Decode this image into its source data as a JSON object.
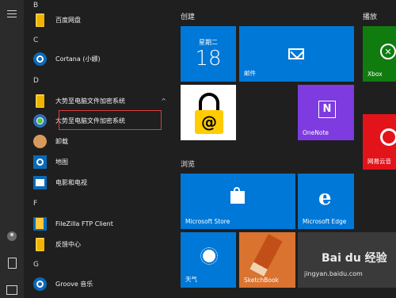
{
  "start_menu": {
    "rail": {
      "menu_icon": "hamburger-icon",
      "user_icon": "user-icon",
      "documents_icon": "document-icon",
      "pictures_icon": "pictures-icon"
    },
    "app_list": {
      "letters": {
        "b": "B",
        "c": "C",
        "d": "D",
        "f": "F",
        "g": "G"
      },
      "items": [
        {
          "label": "百度网盘",
          "icon": "folder-icon"
        },
        {
          "label": "Cortana (小娜)",
          "icon": "cortana-icon"
        },
        {
          "label": "大势至电脑文件加密系统",
          "icon": "folder-icon",
          "chevron": "^"
        },
        {
          "label": "大势至电脑文件加密系统",
          "icon": "app-icon"
        },
        {
          "label": "卸载",
          "icon": "uninstall-icon"
        },
        {
          "label": "地图",
          "icon": "maps-icon"
        },
        {
          "label": "电影和电视",
          "icon": "movies-icon"
        },
        {
          "label": "FileZilla FTP Client",
          "icon": "filezilla-icon"
        },
        {
          "label": "反馈中心",
          "icon": "feedback-icon"
        },
        {
          "label": "Groove 音乐",
          "icon": "groove-icon"
        }
      ]
    },
    "tiles": {
      "groups": {
        "create": "创建",
        "browse": "浏览",
        "play": "播放"
      },
      "calendar": {
        "day": "星期二",
        "date": "18"
      },
      "mail": {
        "label": "邮件"
      },
      "onenote": {
        "label": "OneNote",
        "glyph": "N"
      },
      "xbox": {
        "label": "Xbox",
        "glyph": "✕"
      },
      "netease": {
        "label": "网易云音"
      },
      "store": {
        "label": "Microsoft Store"
      },
      "edge": {
        "label": "Microsoft Edge",
        "glyph": "e"
      },
      "weather": {
        "label": "天气"
      },
      "sketchbook": {
        "label": "SketchBook"
      },
      "lock_glyph": "@"
    },
    "watermark": {
      "brand": "Bai du 经验",
      "url": "jingyan.baidu.com"
    }
  }
}
